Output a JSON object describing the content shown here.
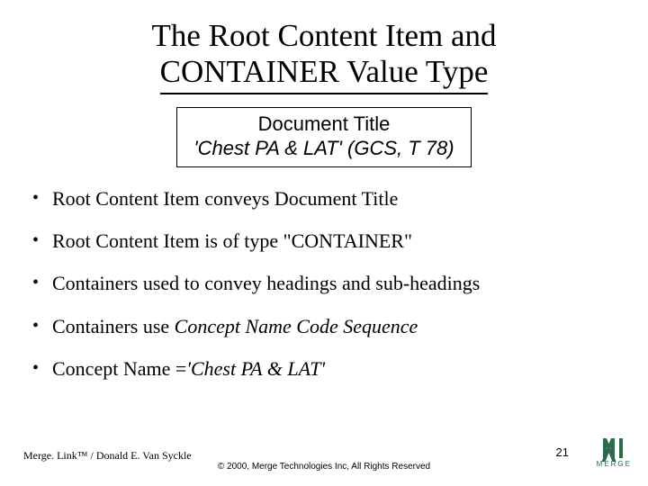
{
  "title": {
    "line1": "The Root Content Item and",
    "line2": "CONTAINER Value Type"
  },
  "box": {
    "line1": "Document Title",
    "line2": "'Chest PA & LAT' (GCS, T 78)"
  },
  "bullets": [
    {
      "text": "Root Content Item conveys Document Title"
    },
    {
      "text": "Root Content Item is of type \"CONTAINER\""
    },
    {
      "text": "Containers used to convey headings and sub-headings"
    },
    {
      "prefix": "Containers use ",
      "italic": "Concept  Name Code Sequence"
    },
    {
      "prefix": "Concept Name =",
      "italic": "'Chest PA & LAT'"
    }
  ],
  "footer": {
    "left": "Merge. Link™ / Donald E. Van Syckle",
    "center": "© 2000, Merge Technologies Inc, All Rights Reserved",
    "pagenum": "21",
    "logo_text": "MERGE"
  }
}
